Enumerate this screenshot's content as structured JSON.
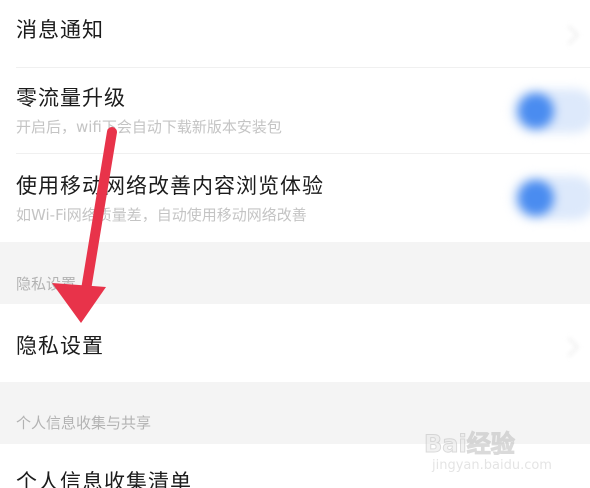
{
  "settings": {
    "message_notification": {
      "title": "消息通知"
    },
    "zero_data_upgrade": {
      "title": "零流量升级",
      "subtitle": "开启后，wifi下会自动下载新版本安装包",
      "enabled": true
    },
    "mobile_network_boost": {
      "title": "使用移动网络改善内容浏览体验",
      "subtitle": "如Wi-Fi网络质量差，自动使用移动网络改善",
      "enabled": true
    },
    "privacy_section": {
      "label": "隐私设置",
      "item_title": "隐私设置"
    },
    "personal_info_section": {
      "label": "个人信息收集与共享",
      "item_title": "个人信息收集清单"
    }
  },
  "watermark": {
    "logo_text": "Bai经验",
    "url": "jingyan.baidu.com"
  },
  "colors": {
    "toggle_on": "#4a8cf0",
    "annotation_arrow": "#e8334a",
    "section_background": "#f4f4f4"
  }
}
